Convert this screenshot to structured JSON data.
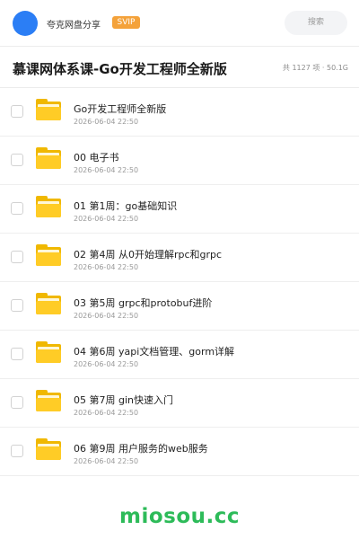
{
  "header": {
    "owner_name": "夸克网盘分享",
    "badge": "SVIP",
    "search_placeholder": "搜索"
  },
  "title_bar": {
    "title": "慕课网体系课-Go开发工程师全新版",
    "summary": "共 1127 项 · 50.1G"
  },
  "items": [
    {
      "name": "Go开发工程师全新版",
      "date": "2026-06-04 22:50",
      "icon": "folder-icon"
    },
    {
      "name": "00 电子书",
      "date": "2026-06-04 22:50",
      "icon": "folder-icon"
    },
    {
      "name": "01 第1周：go基础知识",
      "date": "2026-06-04 22:50",
      "icon": "folder-icon"
    },
    {
      "name": "02 第4周 从0开始理解rpc和grpc",
      "date": "2026-06-04 22:50",
      "icon": "folder-icon"
    },
    {
      "name": "03 第5周 grpc和protobuf进阶",
      "date": "2026-06-04 22:50",
      "icon": "folder-icon"
    },
    {
      "name": "04 第6周 yapi文档管理、gorm详解",
      "date": "2026-06-04 22:50",
      "icon": "folder-icon"
    },
    {
      "name": "05 第7周 gin快速入门",
      "date": "2026-06-04 22:50",
      "icon": "folder-icon"
    },
    {
      "name": "06 第9周 用户服务的web服务",
      "date": "2026-06-04 22:50",
      "icon": "folder-icon"
    }
  ],
  "watermark": "miosou.cc",
  "colors": {
    "avatar": "#2b7ef5",
    "badge": "#f4a23a",
    "folder": "#ffcc26",
    "watermark": "#2dbb59"
  }
}
